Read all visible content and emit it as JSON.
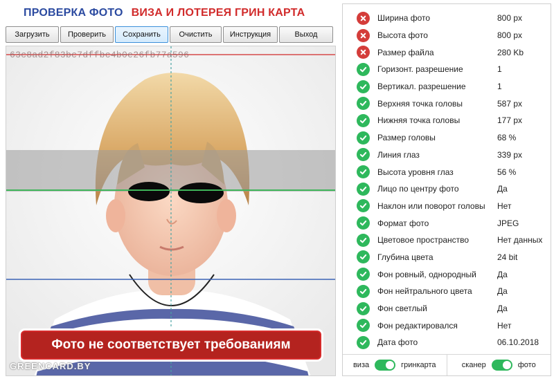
{
  "header": {
    "title_left": "ПРОВЕРКА ФОТО",
    "title_right": "ВИЗА И ЛОТЕРЕЯ ГРИН КАРТА"
  },
  "toolbar": [
    {
      "label": "Загрузить",
      "active": false
    },
    {
      "label": "Проверить",
      "active": false
    },
    {
      "label": "Сохранить",
      "active": true
    },
    {
      "label": "Очистить",
      "active": false
    },
    {
      "label": "Инструкция",
      "active": false
    },
    {
      "label": "Выход",
      "active": false
    }
  ],
  "photo": {
    "hash": "63c8ad2f83bc7dffbc4b0e26fb77a596",
    "verdict": "Фото не соответствует требованиям",
    "watermark": "GREENCARD.BY"
  },
  "colors": {
    "ok": "#2eb85c",
    "error": "#d43d3a",
    "title_blue": "#2b4aa0",
    "title_red": "#d12b2b"
  },
  "checks": [
    {
      "label": "Ширина фото",
      "value": "800 px",
      "status": "error"
    },
    {
      "label": "Высота фото",
      "value": "800 px",
      "status": "error"
    },
    {
      "label": "Размер файла",
      "value": "280 Kb",
      "status": "error"
    },
    {
      "label": "Горизонт. разрешение",
      "value": "1",
      "status": "ok"
    },
    {
      "label": "Вертикал. разрешение",
      "value": "1",
      "status": "ok"
    },
    {
      "label": "Верхняя точка головы",
      "value": "587 px",
      "status": "ok"
    },
    {
      "label": "Нижняя точка головы",
      "value": "177 px",
      "status": "ok"
    },
    {
      "label": "Размер головы",
      "value": "68 %",
      "status": "ok"
    },
    {
      "label": "Линия глаз",
      "value": "339 px",
      "status": "ok"
    },
    {
      "label": "Высота уровня глаз",
      "value": "56 %",
      "status": "ok"
    },
    {
      "label": "Лицо по центру фото",
      "value": "Да",
      "status": "ok"
    },
    {
      "label": "Наклон или поворот головы",
      "value": "Нет",
      "status": "ok"
    },
    {
      "label": "Формат фото",
      "value": "JPEG",
      "status": "ok"
    },
    {
      "label": "Цветовое пространство",
      "value": "Нет данных",
      "status": "ok"
    },
    {
      "label": "Глубина цвета",
      "value": "24 bit",
      "status": "ok"
    },
    {
      "label": "Фон ровный, однородный",
      "value": "Да",
      "status": "ok"
    },
    {
      "label": "Фон нейтрального цвета",
      "value": "Да",
      "status": "ok"
    },
    {
      "label": "Фон светлый",
      "value": "Да",
      "status": "ok"
    },
    {
      "label": "Фон редактировался",
      "value": "Нет",
      "status": "ok"
    },
    {
      "label": "Дата фото",
      "value": "06.10.2018",
      "status": "ok"
    }
  ],
  "toggles": [
    {
      "left": "виза",
      "right": "гринкарта",
      "state": "on"
    },
    {
      "left": "сканер",
      "right": "фото",
      "state": "on"
    }
  ]
}
